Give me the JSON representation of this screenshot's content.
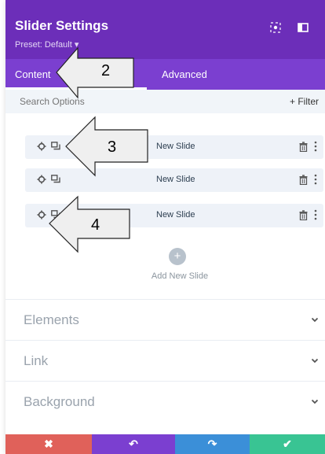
{
  "header": {
    "title": "Slider Settings",
    "preset": "Preset: Default ▾",
    "bg_color": "#6c2eb9",
    "icons": [
      "focus-icon",
      "sidebar-toggle-icon"
    ]
  },
  "tabs": [
    {
      "label": "Content",
      "active": true
    },
    {
      "label": "Advanced",
      "active": false
    }
  ],
  "search": {
    "placeholder": "Search Options",
    "filter_label": "+ Filter"
  },
  "slides": [
    {
      "label": "New Slide"
    },
    {
      "label": "New Slide"
    },
    {
      "label": "New Slide"
    }
  ],
  "add_slide": {
    "icon": "+",
    "label": "Add New Slide"
  },
  "sections": [
    {
      "label": "Elements"
    },
    {
      "label": "Link"
    },
    {
      "label": "Background"
    }
  ],
  "bottom_bar": {
    "cancel": {
      "glyph": "✖",
      "color": "#e0615a"
    },
    "undo": {
      "glyph": "↶",
      "color": "#7b3fd0"
    },
    "redo": {
      "glyph": "↷",
      "color": "#3b8fd8"
    },
    "save": {
      "glyph": "✔",
      "color": "#39c493"
    }
  },
  "callouts": [
    {
      "number": "2"
    },
    {
      "number": "3"
    },
    {
      "number": "4"
    }
  ]
}
